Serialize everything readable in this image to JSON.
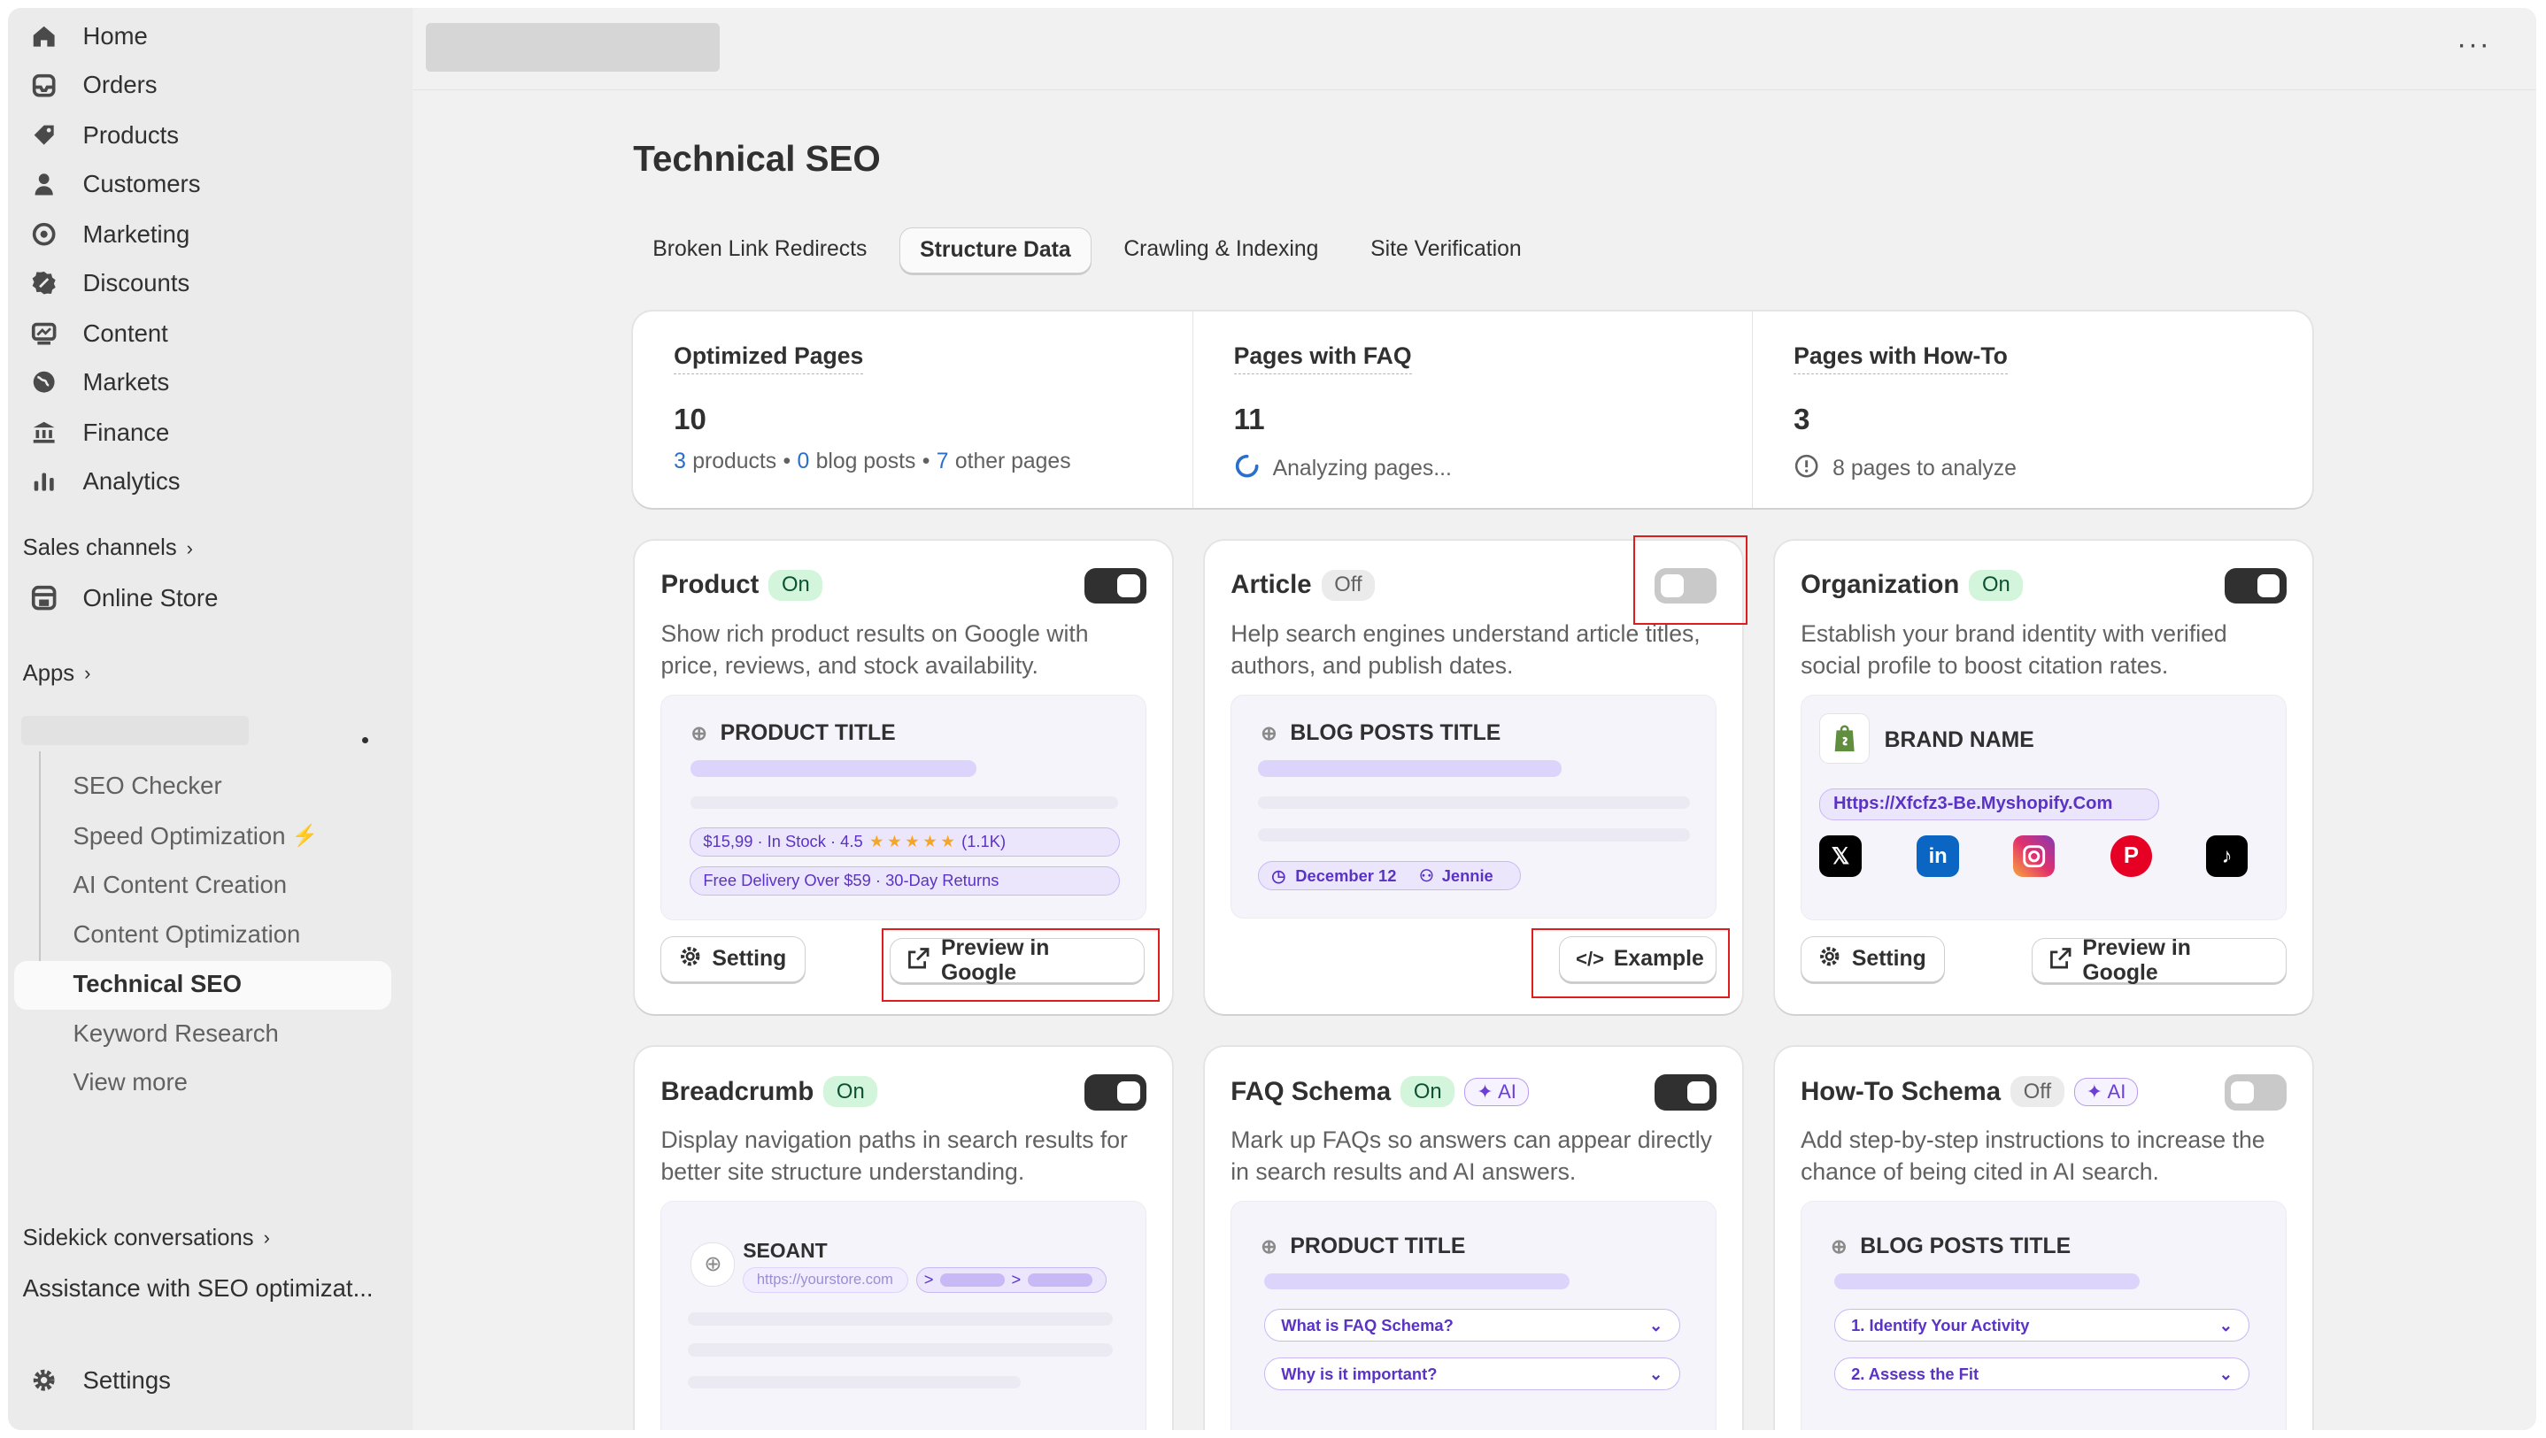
{
  "sidebar": {
    "nav": [
      {
        "label": "Home",
        "icon": "home-icon"
      },
      {
        "label": "Orders",
        "icon": "inbox-icon"
      },
      {
        "label": "Products",
        "icon": "tag-icon"
      },
      {
        "label": "Customers",
        "icon": "person-icon"
      },
      {
        "label": "Marketing",
        "icon": "target-icon"
      },
      {
        "label": "Discounts",
        "icon": "discount-icon"
      },
      {
        "label": "Content",
        "icon": "content-icon"
      },
      {
        "label": "Markets",
        "icon": "globe-icon"
      },
      {
        "label": "Finance",
        "icon": "bank-icon"
      },
      {
        "label": "Analytics",
        "icon": "bar-chart-icon"
      }
    ],
    "sales_channels_label": "Sales channels",
    "online_store_label": "Online Store",
    "apps_label": "Apps",
    "app_subitems": [
      {
        "label": "SEO Checker"
      },
      {
        "label": "Speed Optimization",
        "suffix": "⚡"
      },
      {
        "label": "AI Content Creation"
      },
      {
        "label": "Content Optimization"
      },
      {
        "label": "Technical SEO"
      },
      {
        "label": "Keyword Research"
      },
      {
        "label": "View more"
      }
    ],
    "sidekick_label": "Sidekick conversations",
    "sidekick_item": "Assistance with SEO optimizat...",
    "settings_label": "Settings"
  },
  "page": {
    "title": "Technical SEO",
    "tabs": [
      "Broken Link Redirects",
      "Structure Data",
      "Crawling & Indexing",
      "Site Verification"
    ],
    "active_tab": "Structure Data"
  },
  "stats": [
    {
      "label": "Optimized Pages",
      "value": "10",
      "products": "3",
      "products_text": "products",
      "blog": "0",
      "blog_text": "blog posts",
      "other": "7",
      "other_text": "other pages"
    },
    {
      "label": "Pages with FAQ",
      "value": "11",
      "sub": "Analyzing pages..."
    },
    {
      "label": "Pages with How-To",
      "value": "3",
      "sub": "8 pages to analyze"
    }
  ],
  "cards": {
    "product": {
      "title": "Product",
      "status": "On",
      "desc": "Show rich product results on Google with price, reviews, and stock availability.",
      "preview_title": "PRODUCT TITLE",
      "price_pill": "$15,99 · In Stock · 4.5",
      "rating_count": "(1.1K)",
      "delivery_pill": "Free Delivery Over $59 · 30-Day Returns",
      "btn_setting": "Setting",
      "btn_preview": "Preview in Google"
    },
    "article": {
      "title": "Article",
      "status": "Off",
      "desc": "Help search engines understand article titles, authors, and publish dates.",
      "preview_title": "BLOG POSTS TITLE",
      "date": "December 12",
      "author": "Jennie",
      "btn_example": "Example"
    },
    "organization": {
      "title": "Organization",
      "status": "On",
      "desc": "Establish your brand identity with verified social profile to boost citation rates.",
      "brand": "BRAND NAME",
      "url": "Https://Xfcfz3-Be.Myshopify.Com",
      "socials": [
        "x-icon",
        "linkedin-icon",
        "instagram-icon",
        "pinterest-icon",
        "tiktok-icon"
      ],
      "btn_setting": "Setting",
      "btn_preview": "Preview in Google"
    },
    "breadcrumb": {
      "title": "Breadcrumb",
      "status": "On",
      "desc": "Display navigation paths in search results for better site structure understanding.",
      "site": "SEOANT",
      "site_url": "https://yourstore.com"
    },
    "faq": {
      "title": "FAQ Schema",
      "status": "On",
      "ai": "AI",
      "desc": "Mark up FAQs so answers can appear directly in search results and AI answers.",
      "preview_title": "PRODUCT TITLE",
      "q1": "What is FAQ Schema?",
      "q2": "Why is it important?"
    },
    "howto": {
      "title": "How-To Schema",
      "status": "Off",
      "ai": "AI",
      "desc": "Add step-by-step instructions to increase the chance of being cited in AI search.",
      "preview_title": "BLOG POSTS TITLE",
      "s1": "1. Identify Your Activity",
      "s2": "2. Assess the Fit"
    }
  },
  "colors": {
    "accent_on": "#d3f5dc",
    "ai": "#6a3fd6",
    "link": "#2c6ecb",
    "highlight": "#e01d1d"
  }
}
